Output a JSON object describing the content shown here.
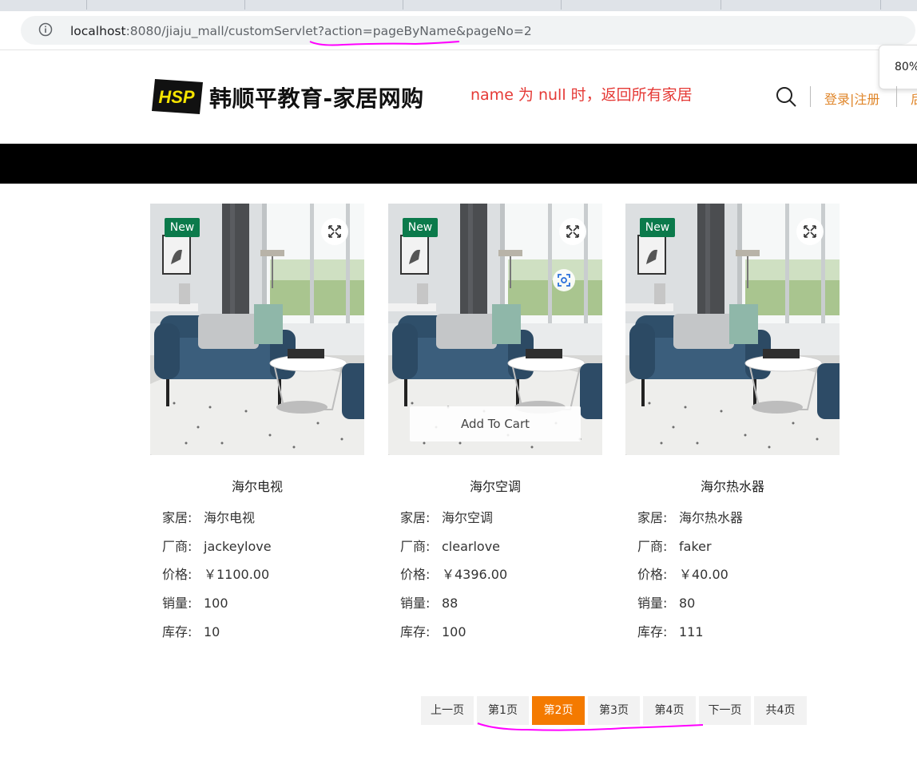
{
  "browser": {
    "url_host": "localhost",
    "url_path": ":8080/jiaju_mall/customServlet?action=pageByName&pageNo=2",
    "zoom": "80%"
  },
  "header": {
    "logo_text": "HSP",
    "site_name": "韩顺平教育-家居网购",
    "note": "name 为 null 时，返回所有家居",
    "login": "登录",
    "separator": "|",
    "register": "注册",
    "extra": "后"
  },
  "colors": {
    "accent": "#f47a00",
    "badge": "#0b7a4b",
    "note": "#e53935",
    "link": "#e0862a"
  },
  "products": [
    {
      "badge": "New",
      "name": "海尔电视",
      "label_type": "家居:",
      "type": "海尔电视",
      "label_maker": "厂商:",
      "maker": "jackeylove",
      "label_price": "价格:",
      "price": "￥1100.00",
      "label_sales": "销量:",
      "sales": "100",
      "label_stock": "库存:",
      "stock": "10"
    },
    {
      "badge": "New",
      "name": "海尔空调",
      "label_type": "家居:",
      "type": "海尔空调",
      "label_maker": "厂商:",
      "maker": "clearlove",
      "label_price": "价格:",
      "price": "￥4396.00",
      "label_sales": "销量:",
      "sales": "88",
      "label_stock": "库存:",
      "stock": "100",
      "cart": "Add To Cart"
    },
    {
      "badge": "New",
      "name": "海尔热水器",
      "label_type": "家居:",
      "type": "海尔热水器",
      "label_maker": "厂商:",
      "maker": "faker",
      "label_price": "价格:",
      "price": "￥40.00",
      "label_sales": "销量:",
      "sales": "80",
      "label_stock": "库存:",
      "stock": "111"
    }
  ],
  "pagination": {
    "prev": "上一页",
    "pages": [
      "第1页",
      "第2页",
      "第3页",
      "第4页"
    ],
    "current": "第2页",
    "next": "下一页",
    "total": "共4页"
  }
}
